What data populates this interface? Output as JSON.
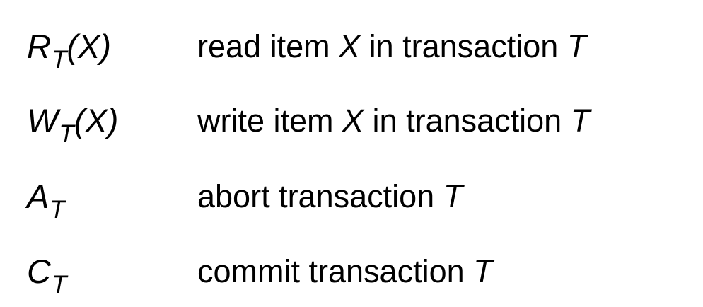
{
  "rows": [
    {
      "symbol": {
        "base": "R",
        "subscript": "T",
        "arg": "(X)"
      },
      "description": {
        "before": "read item ",
        "var1": "X",
        "middle": " in transaction ",
        "var2": "T"
      }
    },
    {
      "symbol": {
        "base": "W",
        "subscript": "T",
        "arg": "(X)"
      },
      "description": {
        "before": "write item ",
        "var1": "X",
        "middle": " in transaction ",
        "var2": "T"
      }
    },
    {
      "symbol": {
        "base": "A",
        "subscript": "T",
        "arg": ""
      },
      "description": {
        "before": "abort transaction ",
        "var2": "T"
      }
    },
    {
      "symbol": {
        "base": "C",
        "subscript": "T",
        "arg": ""
      },
      "description": {
        "before": "commit transaction ",
        "var2": "T"
      }
    }
  ]
}
